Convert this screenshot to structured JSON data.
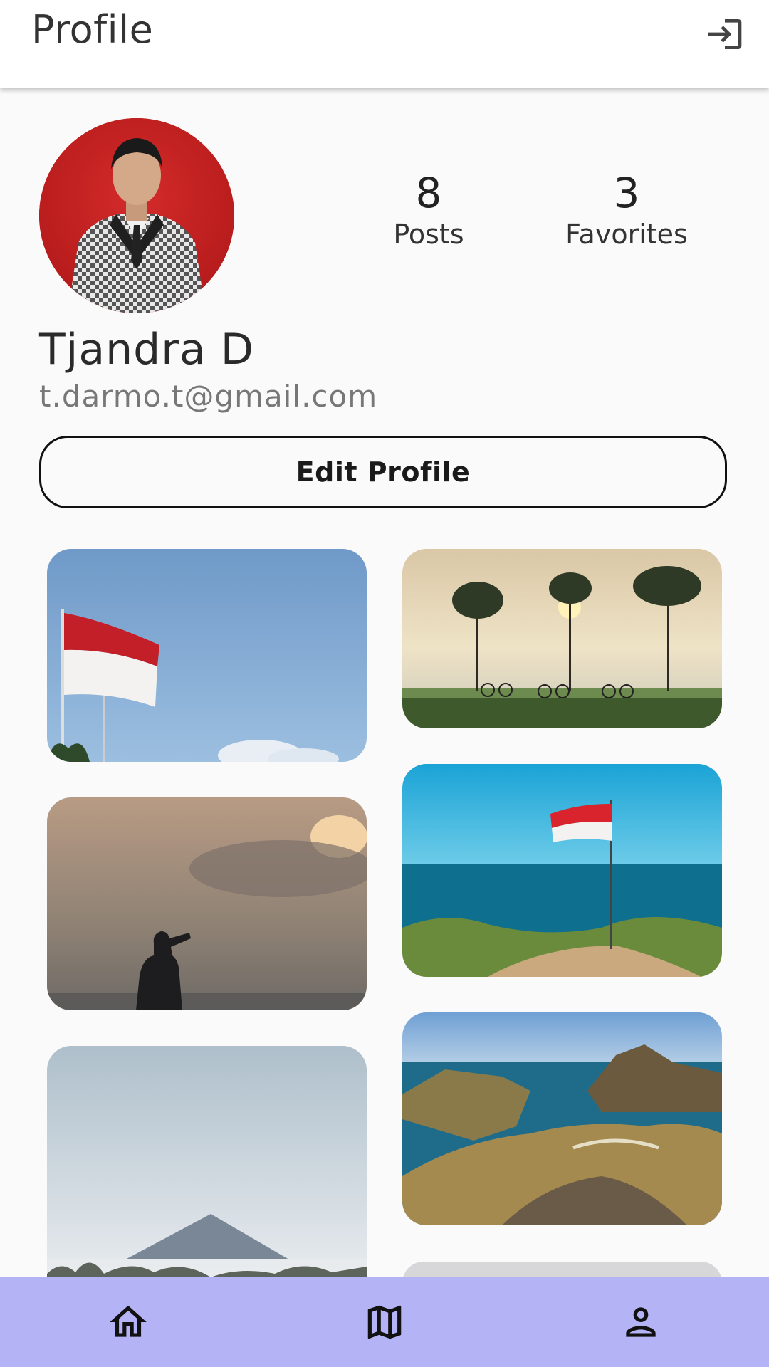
{
  "appbar": {
    "title": "Profile",
    "logout_icon": "logout-icon"
  },
  "profile": {
    "name": "Tjandra D",
    "email": "t.darmo.t@gmail.com",
    "avatar": "profile-photo"
  },
  "stats": [
    {
      "value": "8",
      "label": "Posts"
    },
    {
      "value": "3",
      "label": "Favorites"
    }
  ],
  "edit_button": {
    "label": "Edit Profile"
  },
  "posts": [
    {
      "id": "flag-sky"
    },
    {
      "id": "cyclists-field"
    },
    {
      "id": "sunset-silhouette"
    },
    {
      "id": "flag-coast"
    },
    {
      "id": "mountain-mist"
    },
    {
      "id": "padar-island"
    },
    {
      "id": "partial-post"
    }
  ],
  "bottom_nav": {
    "items": [
      {
        "icon": "home-icon"
      },
      {
        "icon": "map-icon"
      },
      {
        "icon": "person-icon"
      }
    ]
  },
  "colors": {
    "appbar_bg": "#ffffff",
    "page_bg": "#fafafa",
    "bottom_nav_bg": "#b3b3f5"
  }
}
